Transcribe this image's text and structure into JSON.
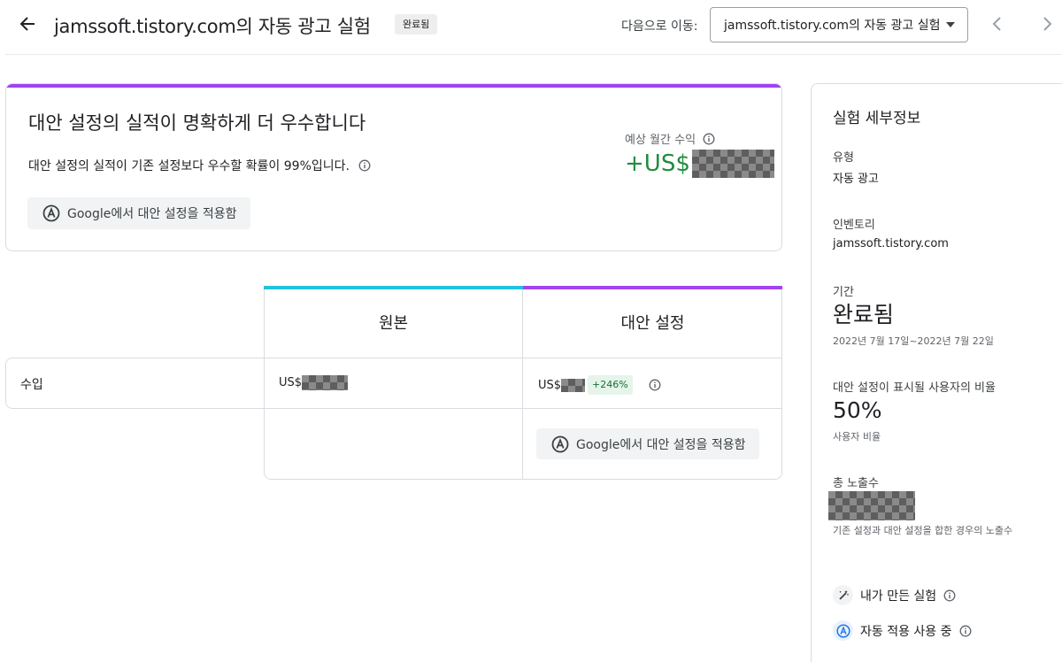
{
  "header": {
    "title": "jamssoft.tistory.com의 자동 광고 실험",
    "status": "완료됨",
    "goto_label": "다음으로 이동:",
    "goto_value": "jamssoft.tistory.com의 자동 광고 실험"
  },
  "summary": {
    "title": "대안 설정의 실적이 명확하게 더 우수합니다",
    "description": "대안 설정의 실적이 기존 설정보다 우수할 확률이 99%입니다.",
    "apply_label": "Google에서 대안 설정을 적용함",
    "revenue_label": "예상 월간 수익",
    "revenue_prefix": "+US$"
  },
  "table": {
    "columns": [
      "원본",
      "대안 설정"
    ],
    "row_label": "수입",
    "original_prefix": "US$",
    "variant_prefix": "US$",
    "variant_change": "+246%",
    "apply_label": "Google에서 대안 설정을 적용함"
  },
  "details": {
    "title": "실험 세부정보",
    "type_label": "유형",
    "type_value": "자동 광고",
    "inventory_label": "인벤토리",
    "inventory_value": "jamssoft.tistory.com",
    "period_label": "기간",
    "period_status": "완료됨",
    "period_dates": "2022년 7월 17일~2022년 7월 22일",
    "ratio_label": "대안 설정이 표시될 사용자의 비율",
    "ratio_value": "50%",
    "ratio_caption": "사용자 비율",
    "impressions_label": "총 노출수",
    "impressions_caption": "기존 설정과 대안 설정을 합한 경우의 노출수",
    "created_by_me": "내가 만든 실험",
    "auto_apply": "자동 적용 사용 중"
  },
  "colors": {
    "original_accent": "#24c1e0",
    "variant_accent": "#a142f4",
    "positive": "#1e8e3e"
  },
  "icons": [
    "back-arrow-icon",
    "chevron-left-icon",
    "chevron-right-icon",
    "info-icon",
    "auto-apply-icon",
    "wand-icon"
  ]
}
